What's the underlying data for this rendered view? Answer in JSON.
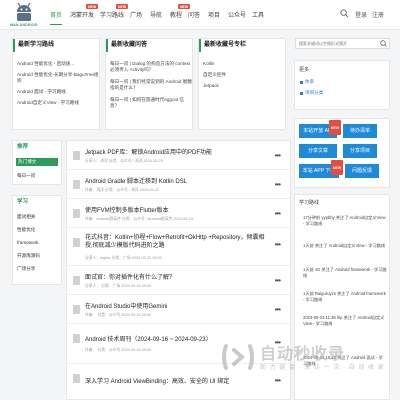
{
  "brand": {
    "logo_text": "WAN ANDROID",
    "accent": "#2d9b5a",
    "link_color": "#2d7bd9",
    "button_blue": "#1f8bd6"
  },
  "nav": {
    "items": [
      {
        "label": "首页",
        "active": true
      },
      {
        "label": "鸿蒙开发",
        "new": true
      },
      {
        "label": "学习路线",
        "new": true
      },
      {
        "label": "广场"
      },
      {
        "label": "导航"
      },
      {
        "label": "教程",
        "new": true
      },
      {
        "label": "问答"
      },
      {
        "label": "项目"
      },
      {
        "label": "公众号"
      },
      {
        "label": "工具"
      }
    ],
    "new_tag": "NEW",
    "search_icon": "search-icon",
    "login": "登录",
    "register": "注册"
  },
  "latest_tasks": {
    "title": "最新学习路线",
    "links": [
      "Android 性能优化 - 启动速...",
      "Android 性能优化-长期分享-BaguTree组织",
      "Android 面试 - 学习路线",
      "Android自定义View - 学习路线"
    ]
  },
  "latest_questions": {
    "title": "最新收藏问答",
    "links": [
      "每日一问 | Dialog 的构造方法的 context 必须传入 Activity吗？",
      "每日一问 | 我们经常说到的 Android 脱糖 指的是什么？",
      "每日一问 | 如何在旅通时代eggcat 信息？"
    ]
  },
  "latest_wechat": {
    "title": "最新收藏号专栏",
    "links": [
      "Kotlin",
      "自定义控件",
      "Jetpack"
    ]
  },
  "sidebar": {
    "recommend_title": "推荐",
    "recommend_items": [
      {
        "label": "热门博文",
        "active": true
      },
      {
        "label": "每日一问"
      }
    ],
    "study_title": "学习",
    "study_items": [
      "面试相关",
      "性能优化",
      "framework",
      "开源库源码",
      "广场分享"
    ]
  },
  "feed": {
    "posts": [
      {
        "title": "Jetpack PDF库：解锁Android应用中的PDF功能",
        "meta": "分享人：鸿洋  分类：公众号 / 鸿洋  2024-09-23"
      },
      {
        "title": "Android Gradle 脚本迁移到 Kotlin DSL",
        "meta": "作者：鸿洋  分类：公众号 / 鸿洋  2024-09-22"
      },
      {
        "title": "使用FVM控制多版本Flutter版本",
        "meta": "作者：Android群英传  分类：公众号 / Android群英传  2024-09-23"
      },
      {
        "title": "花式抖音：Kotlin+协程+Flow+Retrofit+OkHttp +Repository，倾囊相授,彻底减少模版代码进阶之路",
        "meta": "分享人：wgllss  分类：广场  2024-09-23 16:09"
      },
      {
        "title": "面试官：你对插件化有什么了解？",
        "meta": "分享人：  分类：广场  2024-09-24 00:00"
      },
      {
        "title": "在Android Studio中使用Gemini",
        "meta": "作者：  分类：公众号  2024-09-24 00:00"
      },
      {
        "title": "Android 技术周刊（2024-09-16 ~ 2024-09-23）",
        "meta": "作者：  分类：公众号  2024-09-24 00:00"
      },
      {
        "title": "深入学习 Android ViewBinding：高效、安全的 UI 绑定",
        "meta": ""
      }
    ],
    "more_icon": "more-dots-icon"
  },
  "right": {
    "search_placeholder": "搜索关键词以空格形式隔开",
    "more_title": "更多",
    "more_links": [
      "体系",
      "项目分类"
    ],
    "buttons": [
      {
        "label": "本站开放 API",
        "new": true
      },
      {
        "label": "待办清单"
      },
      {
        "label": "分享文章"
      },
      {
        "label": "分享项目"
      },
      {
        "label": "本站 APP 下载",
        "new": true
      },
      {
        "label": "问题反馈"
      }
    ],
    "activity_title": "学习路线",
    "activities": [
      {
        "text": "17分钟前 yypbhy 关注了 Android自定义View - 学习路线"
      },
      {
        "text": "1天前 关注了 Android自定义View - 学习路线"
      },
      {
        "text": "1天前 JG 关注了 Android framework - 学习路线"
      },
      {
        "text": "1天前 Raiguruyzs 关注了 Android framework - 学习路线"
      },
      {
        "text": "2024-09-23 11:36 hlp 关注了 Android自定义View - 学习路线"
      },
      {
        "text": "2024-09-23 10:10 关注了 Android 面试 - 学习路线"
      }
    ]
  },
  "watermark": {
    "text": "自动秒收录",
    "sub": "助 力 链 接 · 来 访 一 次 · 自 动 收 录"
  }
}
